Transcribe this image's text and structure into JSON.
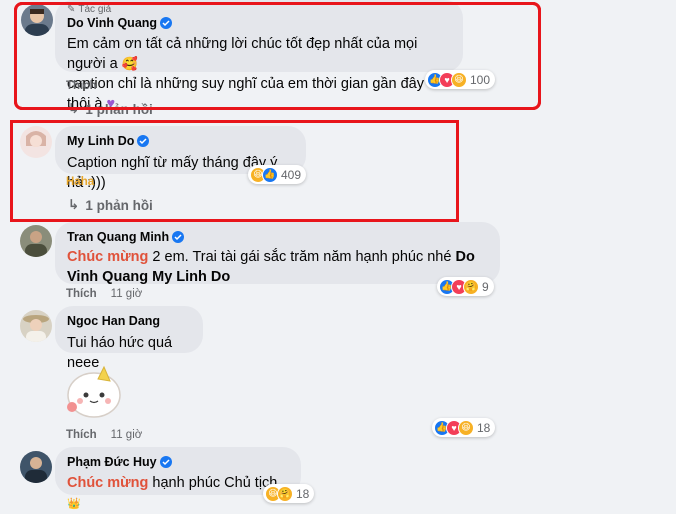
{
  "comments": [
    {
      "badge": "Tác giả",
      "name": "Do Vinh Quang",
      "text_line1": "Em cảm ơn tất cả những lời chúc tốt đẹp nhất của mọi người a",
      "text_line2": "caption chỉ là những suy nghĩ của em thời gian gần đây thôi à",
      "reaction_count": "100",
      "action_like": "Thích",
      "replies": "1 phản hồi"
    },
    {
      "name": "My Linh Do",
      "text": "Caption nghĩ từ mấy tháng đây ý hả :)))",
      "reaction_count": "409",
      "action_haha": "Haha",
      "replies": "1 phản hồi"
    },
    {
      "name": "Tran Quang Minh",
      "congrats": "Chúc mừng",
      "text_rest": " 2 em. Trai tài gái sắc trăm năm hạnh phúc nhé ",
      "mention": "Do Vinh Quang My Linh Do",
      "action_like": "Thích",
      "time": "11 giờ",
      "reaction_count": "9"
    },
    {
      "name": "Ngoc Han Dang",
      "text": "Tui háo hức quá neee",
      "action_like": "Thích",
      "time": "11 giờ",
      "reaction_count": "18"
    },
    {
      "name": "Phạm Đức Huy",
      "congrats": "Chúc mừng",
      "text_rest": " hạnh phúc Chủ tịch",
      "reaction_count": "18"
    }
  ],
  "colors": {
    "highlight": "#e8151b",
    "bubble": "#e4e6eb",
    "congrats": "#e0523a",
    "like_blue": "#1877f2"
  }
}
